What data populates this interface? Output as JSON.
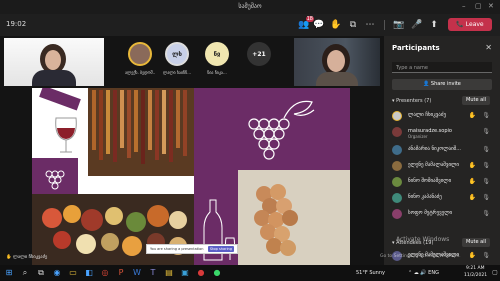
{
  "window": {
    "title": "სამუშაო"
  },
  "toolbar": {
    "timer": "19:02",
    "participants_badge": "18",
    "leave_label": "Leave",
    "colors": {
      "leave": "#c4314b"
    }
  },
  "stage": {
    "avatars": [
      {
        "initials": "",
        "name": "ალექს. ბედოშ.."
      },
      {
        "initials": "ლხ",
        "name": "ლალი ხაინნ..."
      },
      {
        "initials": "ნჲ",
        "name": "ნია ჩიკა..."
      },
      {
        "initials": "+21",
        "name": ""
      }
    ],
    "presenter_label": "ლალი ჩხიკვაძე",
    "notification_text": "Stop sharing",
    "notification_prefix": "You are sharing a presentation"
  },
  "panel": {
    "title": "Participants",
    "search_placeholder": "Type a name",
    "share_invite": "Share invite",
    "presenters_header": "Presenters (7)",
    "mute_all": "Mute all",
    "attendees_header": "Attendees (19)",
    "presenters": [
      {
        "name": "ლალი ჩხიკვაძე",
        "role": "",
        "avatar_color": "#c8c8c8"
      },
      {
        "name": "maisuradze.sopio",
        "role": "Organizer",
        "avatar_color": "#7a3a3a"
      },
      {
        "name": "ანამარია ნიკოლაიშ...",
        "role": "",
        "avatar_color": "#3f6c8a"
      },
      {
        "name": "ელენე მამალაშვილი",
        "role": "",
        "avatar_color": "#8a6b3f"
      },
      {
        "name": "ნინო შოშიაშვილი",
        "role": "",
        "avatar_color": "#6b8a3f"
      },
      {
        "name": "ნინო კაპანაძე",
        "role": "",
        "avatar_color": "#3f8a7a"
      },
      {
        "name": "სოფო მეტრეველი",
        "role": "",
        "avatar_color": "#8a3f6b"
      }
    ],
    "attendees": [
      {
        "name": "ელენე მამულაშვილი",
        "role": "",
        "avatar_color": "#5a5a8a"
      }
    ]
  },
  "taskbar": {
    "weather": "51°F Sunny",
    "time": "9:21 AM",
    "date": "11/2/2021",
    "watermark_1": "Activate Windows",
    "watermark_2": "Go to Settings to activate Windows."
  }
}
